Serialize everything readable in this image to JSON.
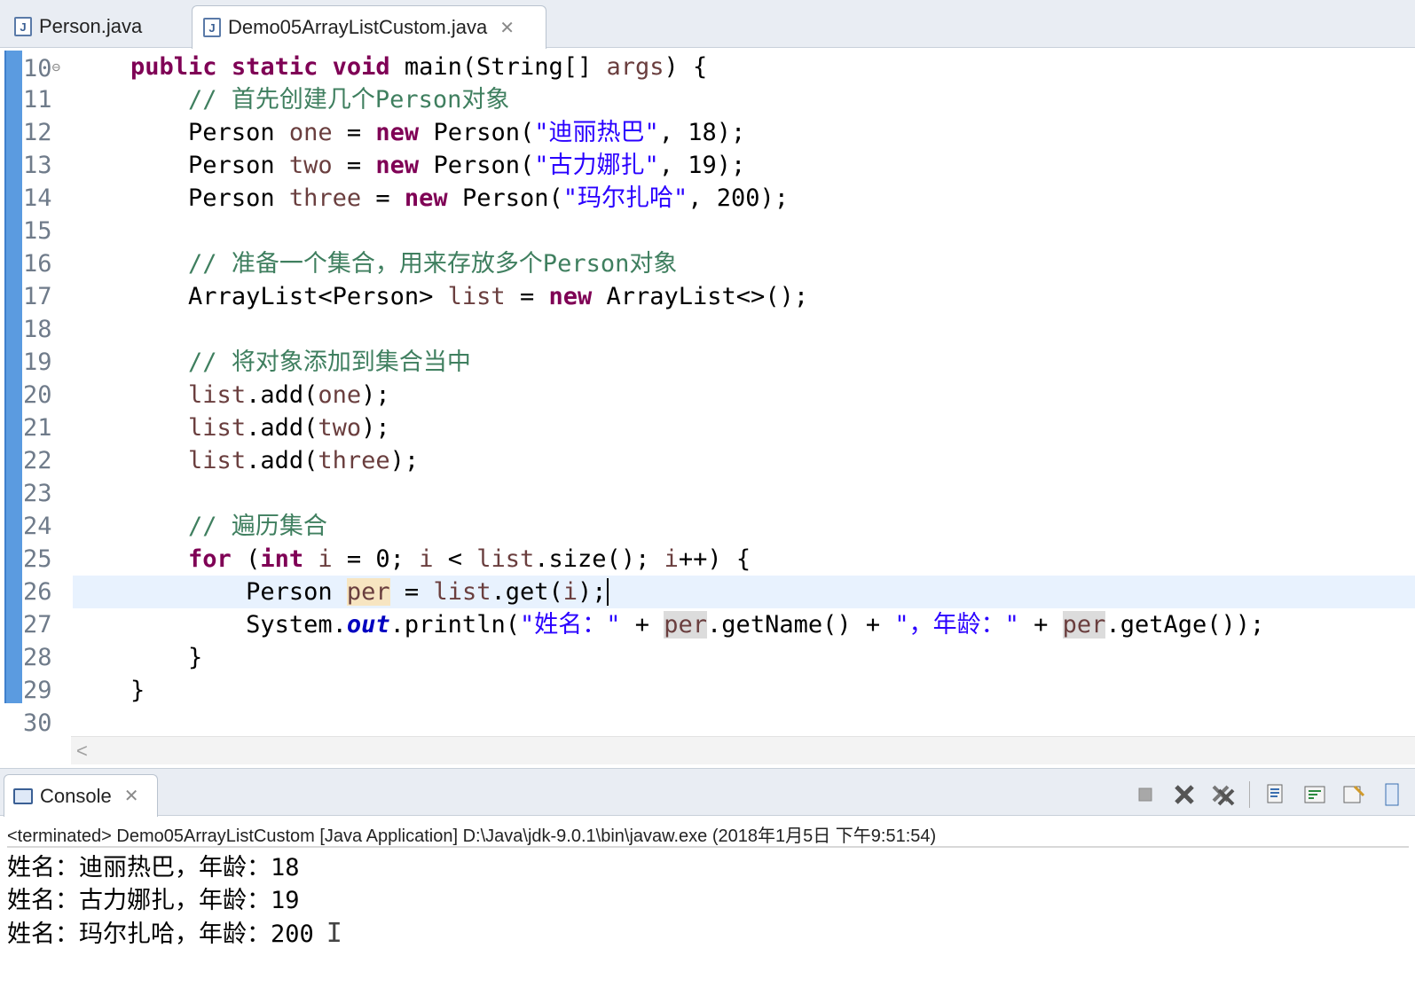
{
  "tabs": [
    {
      "label": "Person.java",
      "active": false
    },
    {
      "label": "Demo05ArrayListCustom.java",
      "active": true
    }
  ],
  "editor": {
    "lines": [
      {
        "num": "10",
        "fold": "⊖"
      },
      {
        "num": "11"
      },
      {
        "num": "12"
      },
      {
        "num": "13"
      },
      {
        "num": "14"
      },
      {
        "num": "15"
      },
      {
        "num": "16"
      },
      {
        "num": "17"
      },
      {
        "num": "18"
      },
      {
        "num": "19"
      },
      {
        "num": "20"
      },
      {
        "num": "21"
      },
      {
        "num": "22"
      },
      {
        "num": "23"
      },
      {
        "num": "24"
      },
      {
        "num": "25"
      },
      {
        "num": "26"
      },
      {
        "num": "27"
      },
      {
        "num": "28"
      },
      {
        "num": "29"
      },
      {
        "num": "30"
      }
    ],
    "code": {
      "l10": {
        "k1": "public static void",
        "t1": " main(String[] ",
        "v1": "args",
        "t2": ") {"
      },
      "l11": {
        "c": "// 首先创建几个Person对象"
      },
      "l12": {
        "t1": "Person ",
        "v1": "one",
        "t2": " = ",
        "k1": "new",
        "t3": " Person(",
        "s1": "\"迪丽热巴\"",
        "t4": ", 18);"
      },
      "l13": {
        "t1": "Person ",
        "v1": "two",
        "t2": " = ",
        "k1": "new",
        "t3": " Person(",
        "s1": "\"古力娜扎\"",
        "t4": ", 19);"
      },
      "l14": {
        "t1": "Person ",
        "v1": "three",
        "t2": " = ",
        "k1": "new",
        "t3": " Person(",
        "s1": "\"玛尔扎哈\"",
        "t4": ", 200);"
      },
      "l16": {
        "c": "// 准备一个集合，用来存放多个Person对象"
      },
      "l17": {
        "t1": "ArrayList<Person> ",
        "v1": "list",
        "t2": " = ",
        "k1": "new",
        "t3": " ArrayList<>();"
      },
      "l19": {
        "c": "// 将对象添加到集合当中"
      },
      "l20": {
        "v1": "list",
        "t1": ".add(",
        "v2": "one",
        "t2": ");"
      },
      "l21": {
        "v1": "list",
        "t1": ".add(",
        "v2": "two",
        "t2": ");"
      },
      "l22": {
        "v1": "list",
        "t1": ".add(",
        "v2": "three",
        "t2": ");"
      },
      "l24": {
        "c": "// 遍历集合"
      },
      "l25": {
        "k1": "for",
        "t1": " (",
        "k2": "int",
        "t2": " ",
        "v1": "i",
        "t3": " = 0; ",
        "v2": "i",
        "t4": " < ",
        "v3": "list",
        "t5": ".size(); ",
        "v4": "i",
        "t6": "++) {"
      },
      "l26": {
        "t1": "Person ",
        "v1": "per",
        "t2": " = ",
        "v2": "list",
        "t3": ".get(",
        "v3": "i",
        "t4": ");"
      },
      "l27": {
        "t1": "System.",
        "f1": "out",
        "t2": ".println(",
        "s1": "\"姓名：\"",
        "t3": " + ",
        "v1": "per",
        "t4": ".getName() + ",
        "s2": "\"，年龄：\"",
        "t5": " + ",
        "v2": "per",
        "t6": ".getAge());"
      },
      "l28": {
        "t1": "}"
      },
      "l29": {
        "t1": "}"
      }
    },
    "scroll_glyph": "<"
  },
  "console": {
    "tab_label": "Console",
    "status": "<terminated> Demo05ArrayListCustom [Java Application] D:\\Java\\jdk-9.0.1\\bin\\javaw.exe (2018年1月5日 下午9:51:54)",
    "output": [
      "姓名：迪丽热巴，年龄：18",
      "姓名：古力娜扎，年龄：19",
      "姓名：玛尔扎哈，年龄：200"
    ],
    "toolbar_icons": [
      "terminate-icon",
      "remove-launch-icon",
      "remove-all-icon",
      "scroll-lock-icon",
      "word-wrap-icon",
      "show-on-output-icon",
      "pin-console-icon"
    ]
  }
}
